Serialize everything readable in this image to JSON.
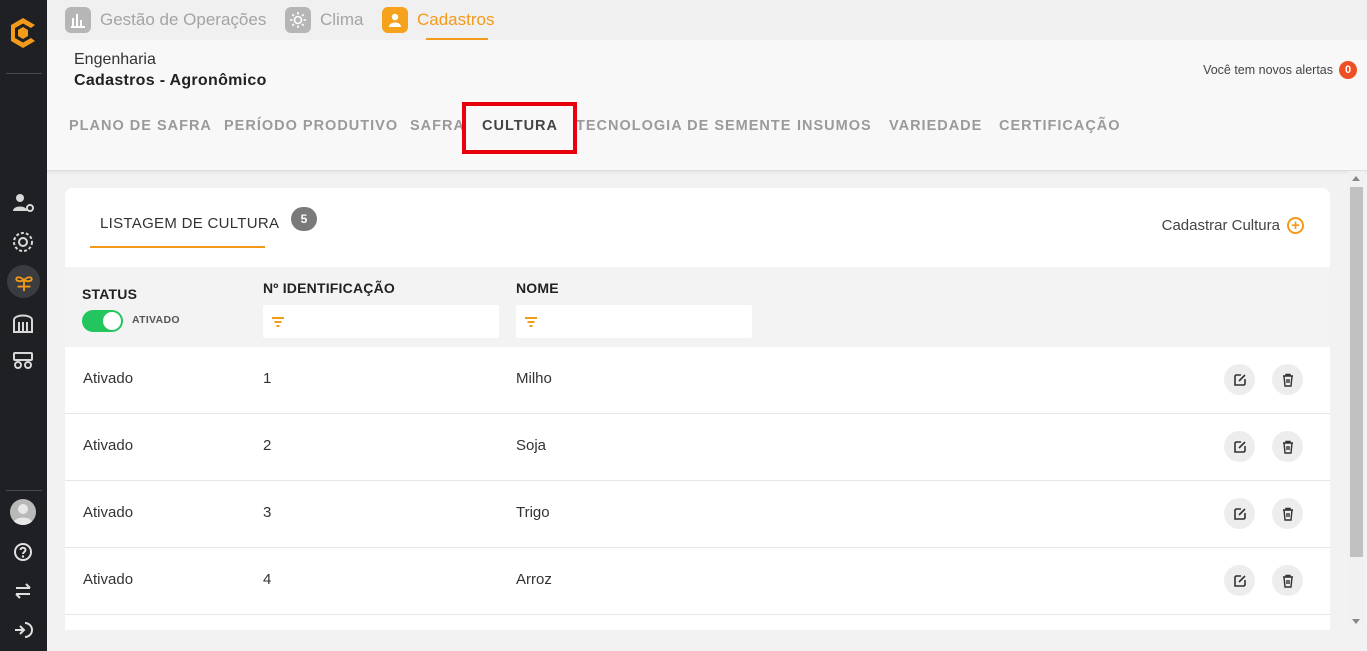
{
  "modules": [
    {
      "label": "Gestão de Operações",
      "icon": "hand-chart-icon"
    },
    {
      "label": "Clima",
      "icon": "sun-icon"
    },
    {
      "label": "Cadastros",
      "icon": "user-icon",
      "active": true
    }
  ],
  "header": {
    "org": "Engenharia",
    "title": "Cadastros - Agronômico",
    "alerts_text": "Você tem novos alertas",
    "alerts_count": "0"
  },
  "tabs": [
    {
      "label": "PLANO DE SAFRA"
    },
    {
      "label": "PERÍODO PRODUTIVO"
    },
    {
      "label": "SAFRA"
    },
    {
      "label": "CULTURA",
      "active": true
    },
    {
      "label": "TECNOLOGIA DE SEMENTE"
    },
    {
      "label": "INSUMOS"
    },
    {
      "label": "VARIEDADE"
    },
    {
      "label": "CERTIFICAÇÃO"
    }
  ],
  "list": {
    "tab_label": "LISTAGEM DE CULTURA",
    "count": "5",
    "add_label": "Cadastrar Cultura"
  },
  "table": {
    "columns": {
      "status": "STATUS",
      "id": "Nº IDENTIFICAÇÃO",
      "name": "NOME"
    },
    "status_filter_label": "ATIVADO",
    "rows": [
      {
        "status": "Ativado",
        "id": "1",
        "name": "Milho"
      },
      {
        "status": "Ativado",
        "id": "2",
        "name": "Soja"
      },
      {
        "status": "Ativado",
        "id": "3",
        "name": "Trigo"
      },
      {
        "status": "Ativado",
        "id": "4",
        "name": "Arroz"
      }
    ]
  },
  "colors": {
    "accent": "#f39a1b",
    "sidebar": "#1f2023",
    "toggle": "#22c55e",
    "alert": "#f04e23",
    "highlight": "#e8000b"
  }
}
